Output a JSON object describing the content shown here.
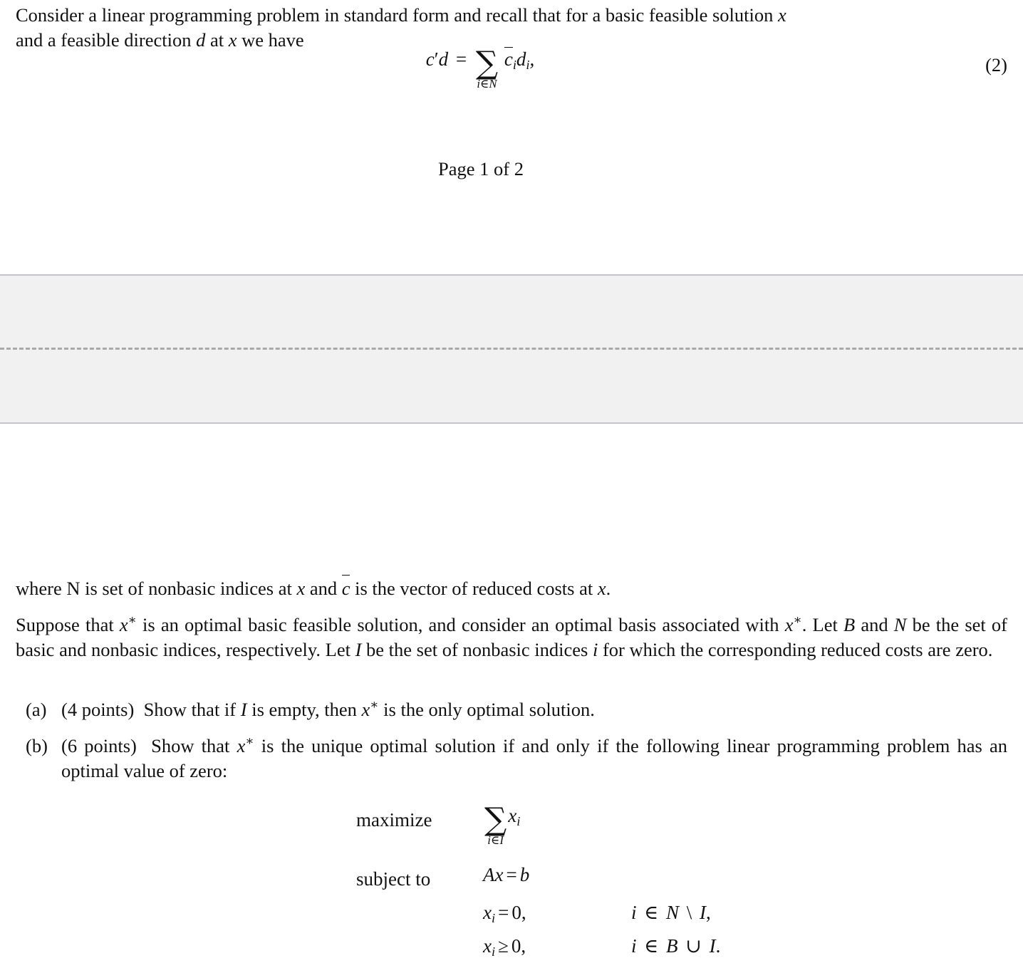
{
  "document": {
    "type": "linear-programming-problem-page",
    "page_indicator": "Page 1 of 2"
  },
  "top_page": {
    "paragraph_line_1": "Consider a linear programming problem in standard form and recall that for a basic feasible solution x",
    "paragraph_line_2": "and a feasible direction d at x we have",
    "equation": {
      "lhs": "c′d",
      "relation": "=",
      "sum_operator": "∑",
      "sum_lower_limit": "i∈N",
      "summand": "c̄ᵢdᵢ,",
      "number": "(2)"
    },
    "page_count_label": "Page 1 of 2"
  },
  "page_gap": {
    "background_color": "#f1f1f1",
    "border_color": "#c2c5cc",
    "divider_color": "#a8a9ad",
    "divider_style": "dashed"
  },
  "bottom_page": {
    "paragraph_where": "where N is set of nonbasic indices at x and c̄ is the vector of reduced costs at x.",
    "paragraph_suppose": "Suppose that x* is an optimal basic feasible solution, and consider an optimal basis associated with x*. Let B and N be the set of basic and nonbasic indices, respectively. Let I be the set of nonbasic indices i for which the corresponding reduced costs are zero.",
    "items": [
      {
        "marker": "(a)",
        "points": "(4 points)",
        "text": "Show that if I is empty, then x* is the only optimal solution."
      },
      {
        "marker": "(b)",
        "points": "(6 points)",
        "text": "Show that x* is the unique optimal solution if and only if the following linear programming problem has an optimal value of zero:"
      }
    ],
    "model": {
      "objective_label": "maximize",
      "objective_sum_operator": "∑",
      "objective_sum_lower_limit": "i∈I",
      "objective_summand": "xᵢ",
      "constraints_label": "subject to",
      "constraints": [
        {
          "expression": "Ax = b",
          "condition": ""
        },
        {
          "expression": "xᵢ = 0,",
          "condition": "i ∈ N \\ I,"
        },
        {
          "expression": "xᵢ ≥ 0,",
          "condition": "i ∈ B ∪ I."
        }
      ]
    }
  }
}
